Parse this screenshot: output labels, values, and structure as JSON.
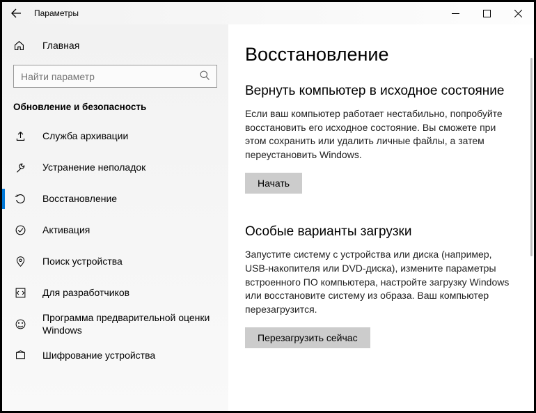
{
  "titlebar": {
    "title": "Параметры"
  },
  "sidebar": {
    "home": "Главная",
    "search_placeholder": "Найти параметр",
    "section": "Обновление и безопасность",
    "items": [
      {
        "label": "Служба архивации"
      },
      {
        "label": "Устранение неполадок"
      },
      {
        "label": "Восстановление"
      },
      {
        "label": "Активация"
      },
      {
        "label": "Поиск устройства"
      },
      {
        "label": "Для разработчиков"
      },
      {
        "label": "Программа предварительной оценки Windows"
      },
      {
        "label": "Шифрование устройства"
      }
    ]
  },
  "content": {
    "page_title": "Восстановление",
    "s1": {
      "title": "Вернуть компьютер в исходное состояние",
      "text": "Если ваш компьютер работает нестабильно, попробуйте восстановить его исходное состояние. Вы сможете при этом сохранить или удалить личные файлы, а затем переустановить Windows.",
      "button": "Начать"
    },
    "s2": {
      "title": "Особые варианты загрузки",
      "text": "Запустите систему с устройства или диска (например, USB-накопителя или DVD-диска), измените параметры встроенного ПО компьютера, настройте загрузку Windows или восстановите систему из образа. Ваш компьютер перезагрузится.",
      "button": "Перезагрузить сейчас"
    }
  }
}
